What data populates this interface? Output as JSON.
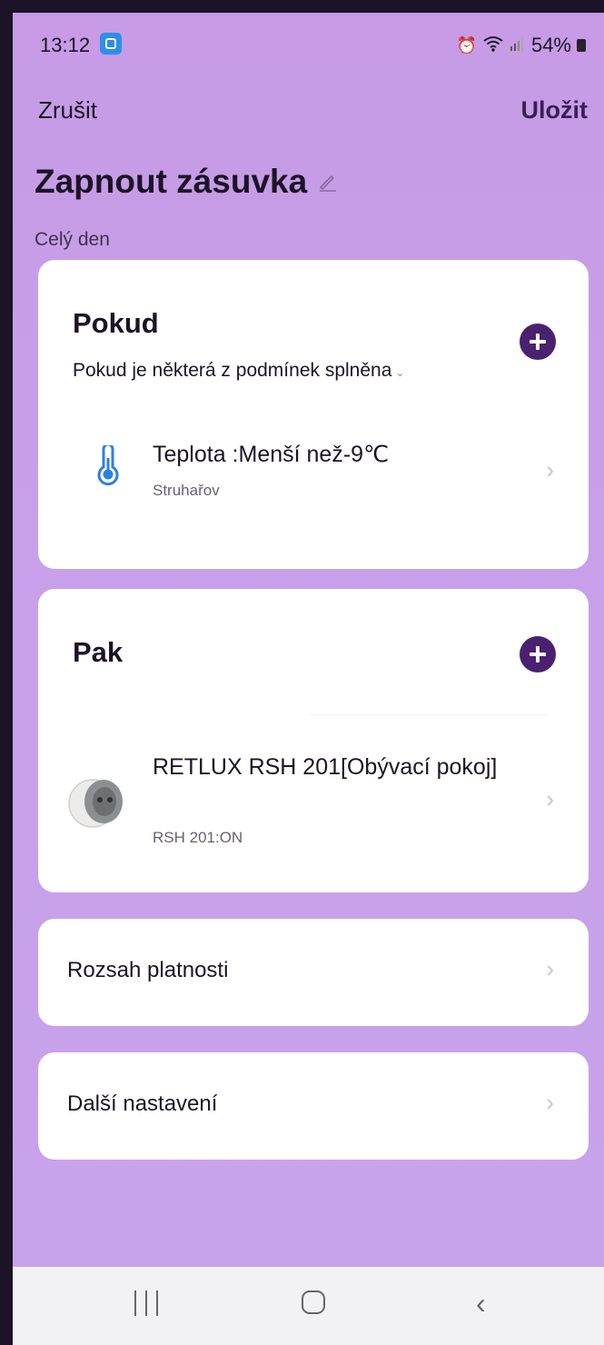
{
  "status_bar": {
    "time": "13:12",
    "app_icon": "app-notification-icon",
    "alarm_icon": "alarm-icon",
    "wifi_icon": "wifi-icon",
    "signal_icon": "signal-icon",
    "battery_text": "54%",
    "battery_icon": "battery-icon"
  },
  "header": {
    "cancel_label": "Zrušit",
    "save_label": "Uložit",
    "title": "Zapnout zásuvka",
    "edit_icon": "pencil-icon",
    "subtitle": "Celý den"
  },
  "if_section": {
    "title": "Pokud",
    "add_icon": "plus-circle-icon",
    "mode": "Pokud je některá z podmínek splněna",
    "mode_chevron": "chevron-down-icon",
    "condition": {
      "title": "Teplota :Menší než-9℃",
      "subtitle": "Struhařov",
      "icon": "thermometer-icon"
    }
  },
  "then_section": {
    "title": "Pak",
    "add_icon": "plus-circle-icon",
    "action": {
      "title": "RETLUX RSH 201[Obývací pokoj]",
      "subtitle": "RSH 201:ON",
      "icon": "smart-plug-icon"
    }
  },
  "scope": {
    "label": "Rozsah platnosti"
  },
  "more_settings": {
    "label": "Další nastavení"
  },
  "nav_bar": {
    "recent_icon": "recent-apps-icon",
    "home_icon": "home-icon",
    "back_icon": "back-icon"
  },
  "colors": {
    "background": "#c79be6",
    "accent": "#4a2170",
    "thermometer": "#2e7fe0"
  }
}
